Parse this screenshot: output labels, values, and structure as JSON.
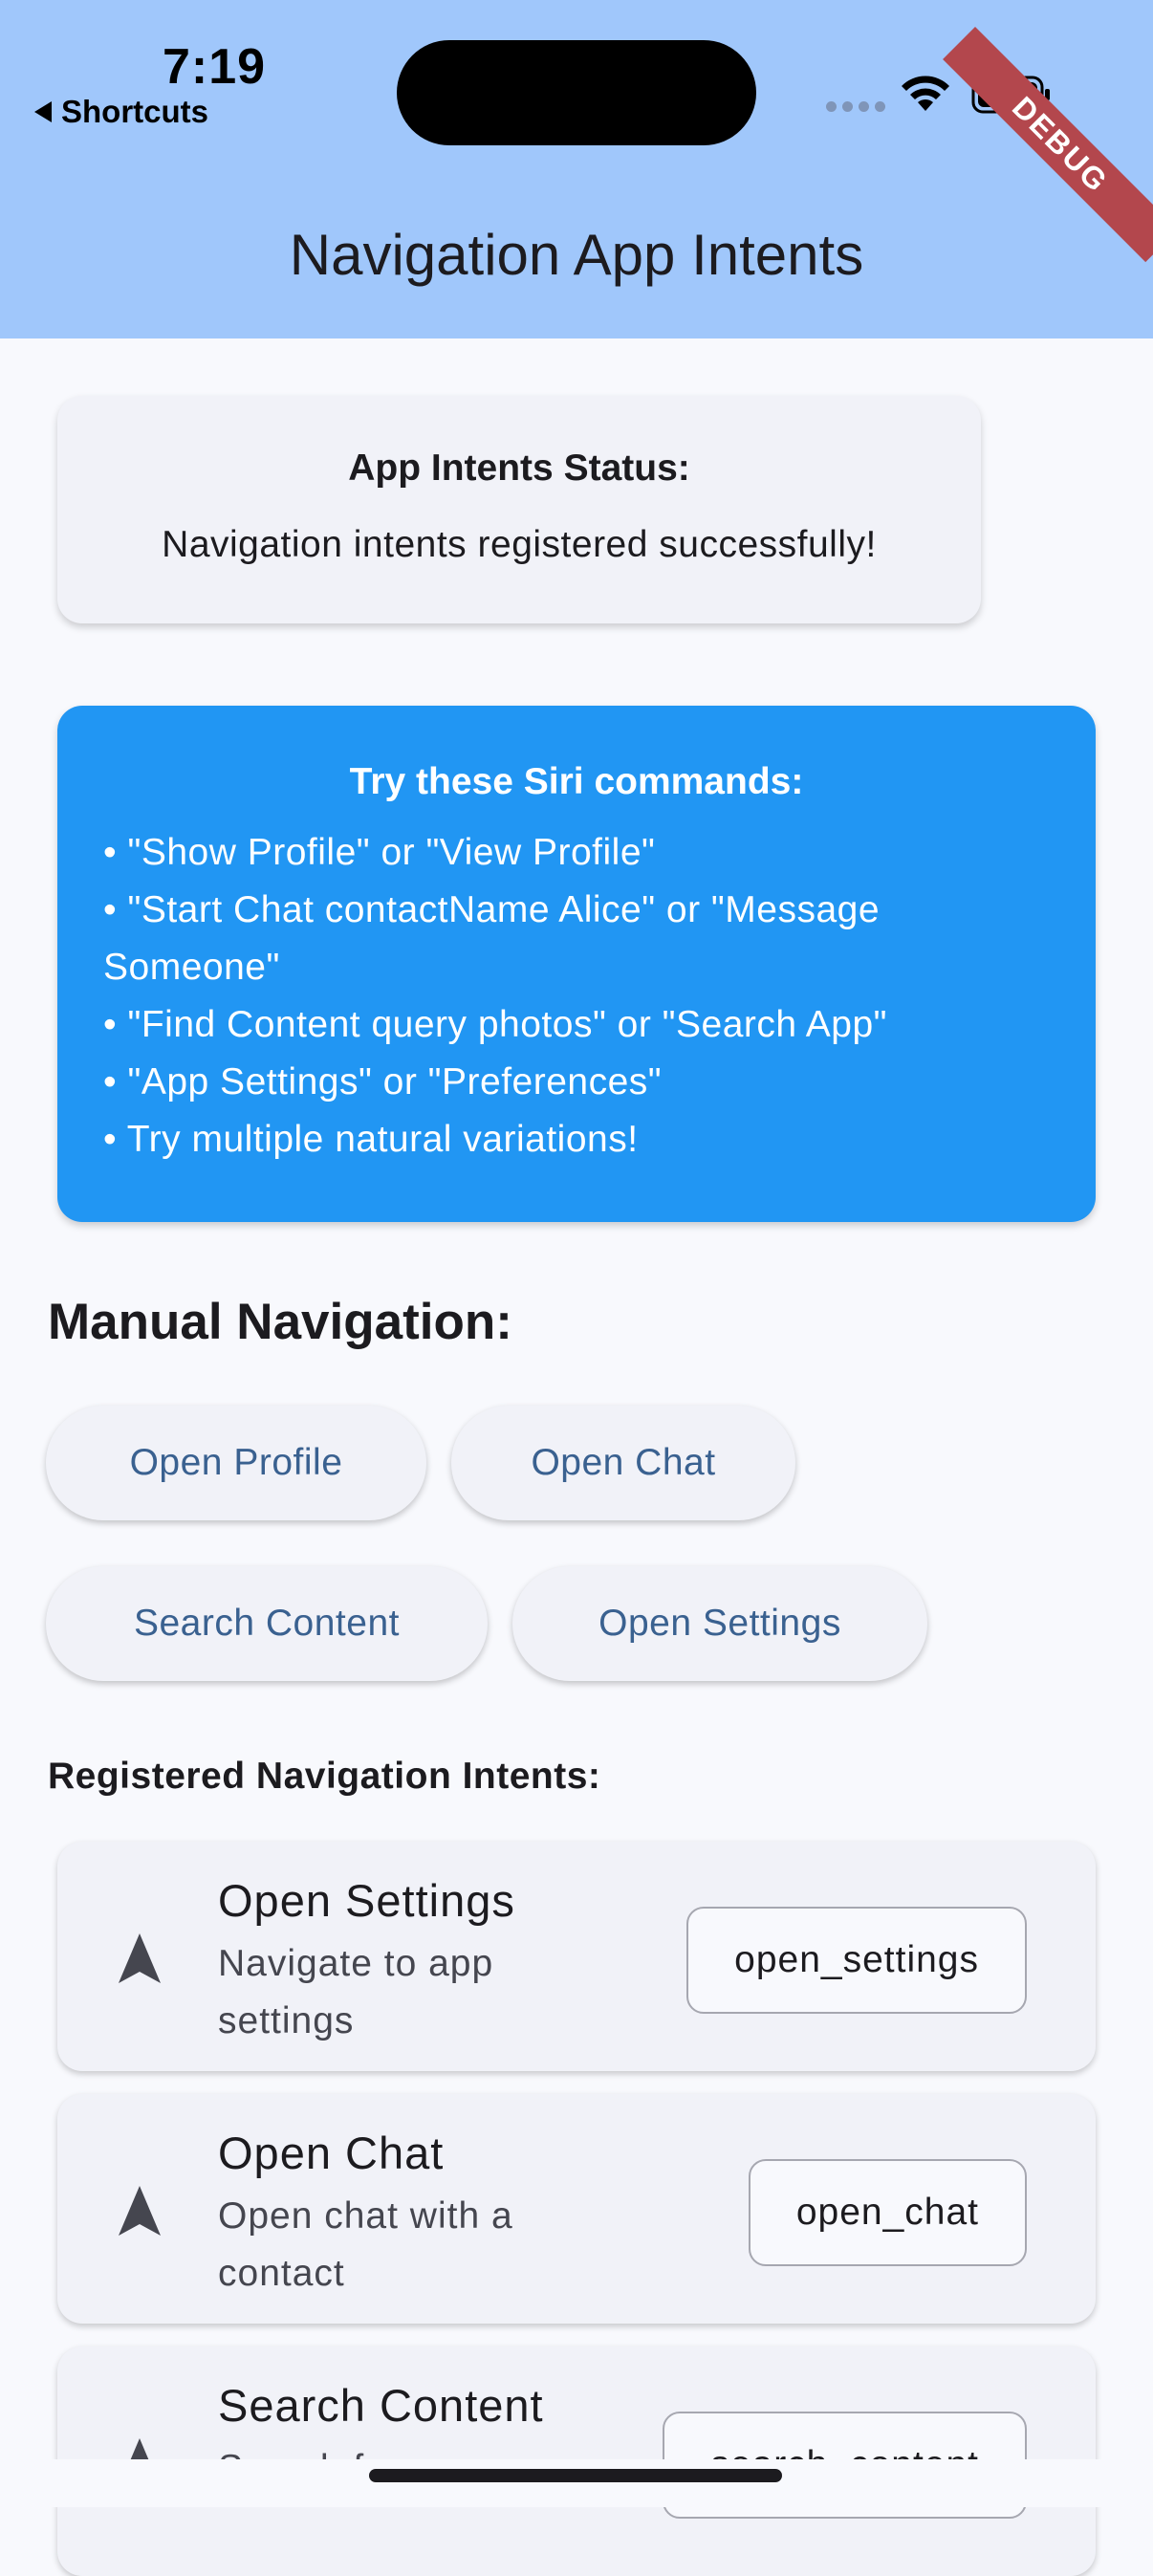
{
  "status_bar": {
    "time": "7:19",
    "back_label": "Shortcuts",
    "debug_label": "DEBUG"
  },
  "app_bar": {
    "title": "Navigation App Intents",
    "background_color": "#a0c7fb"
  },
  "status_card": {
    "heading": "App Intents Status:",
    "message": "Navigation intents registered successfully!"
  },
  "siri_card": {
    "heading": "Try these Siri commands:",
    "lines": [
      "• \"Show Profile\" or \"View Profile\"",
      "• \"Start Chat contactName Alice\" or \"Message Someone\"",
      "• \"Find Content query photos\" or \"Search App\"",
      "• \"App Settings\" or \"Preferences\"",
      "• Try multiple natural variations!"
    ],
    "background_color": "#2196f3"
  },
  "manual_navigation": {
    "title": "Manual Navigation:",
    "buttons": [
      "Open Profile",
      "Open Chat",
      "Search Content",
      "Open Settings"
    ]
  },
  "registered_intents": {
    "title": "Registered Navigation Intents:",
    "items": [
      {
        "name": "Open Settings",
        "description": "Navigate to app settings",
        "id": "open_settings",
        "icon": "navigation-arrow-icon"
      },
      {
        "name": "Open Chat",
        "description": "Open chat with a contact",
        "id": "open_chat",
        "icon": "navigation-arrow-icon"
      },
      {
        "name": "Search Content",
        "description": "Search for",
        "id": "search_content",
        "icon": "navigation-arrow-icon"
      }
    ]
  }
}
